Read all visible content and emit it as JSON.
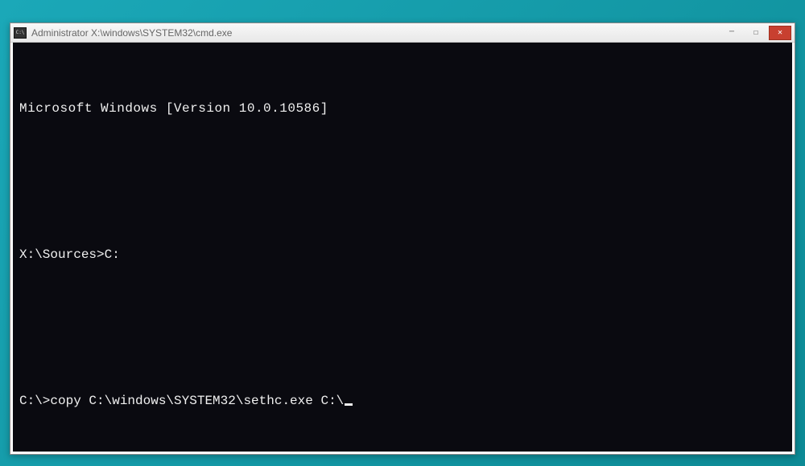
{
  "window": {
    "title": "Administrator  X:\\windows\\SYSTEM32\\cmd.exe"
  },
  "console": {
    "version_line": "Microsoft Windows [Version 10.0.10586]",
    "prompt1_prefix": "X:\\Sources>",
    "prompt1_cmd": "C:",
    "prompt2_prefix": "C:\\>",
    "prompt2_cmd": "copy C:\\windows\\SYSTEM32\\sethc.exe C:\\"
  }
}
